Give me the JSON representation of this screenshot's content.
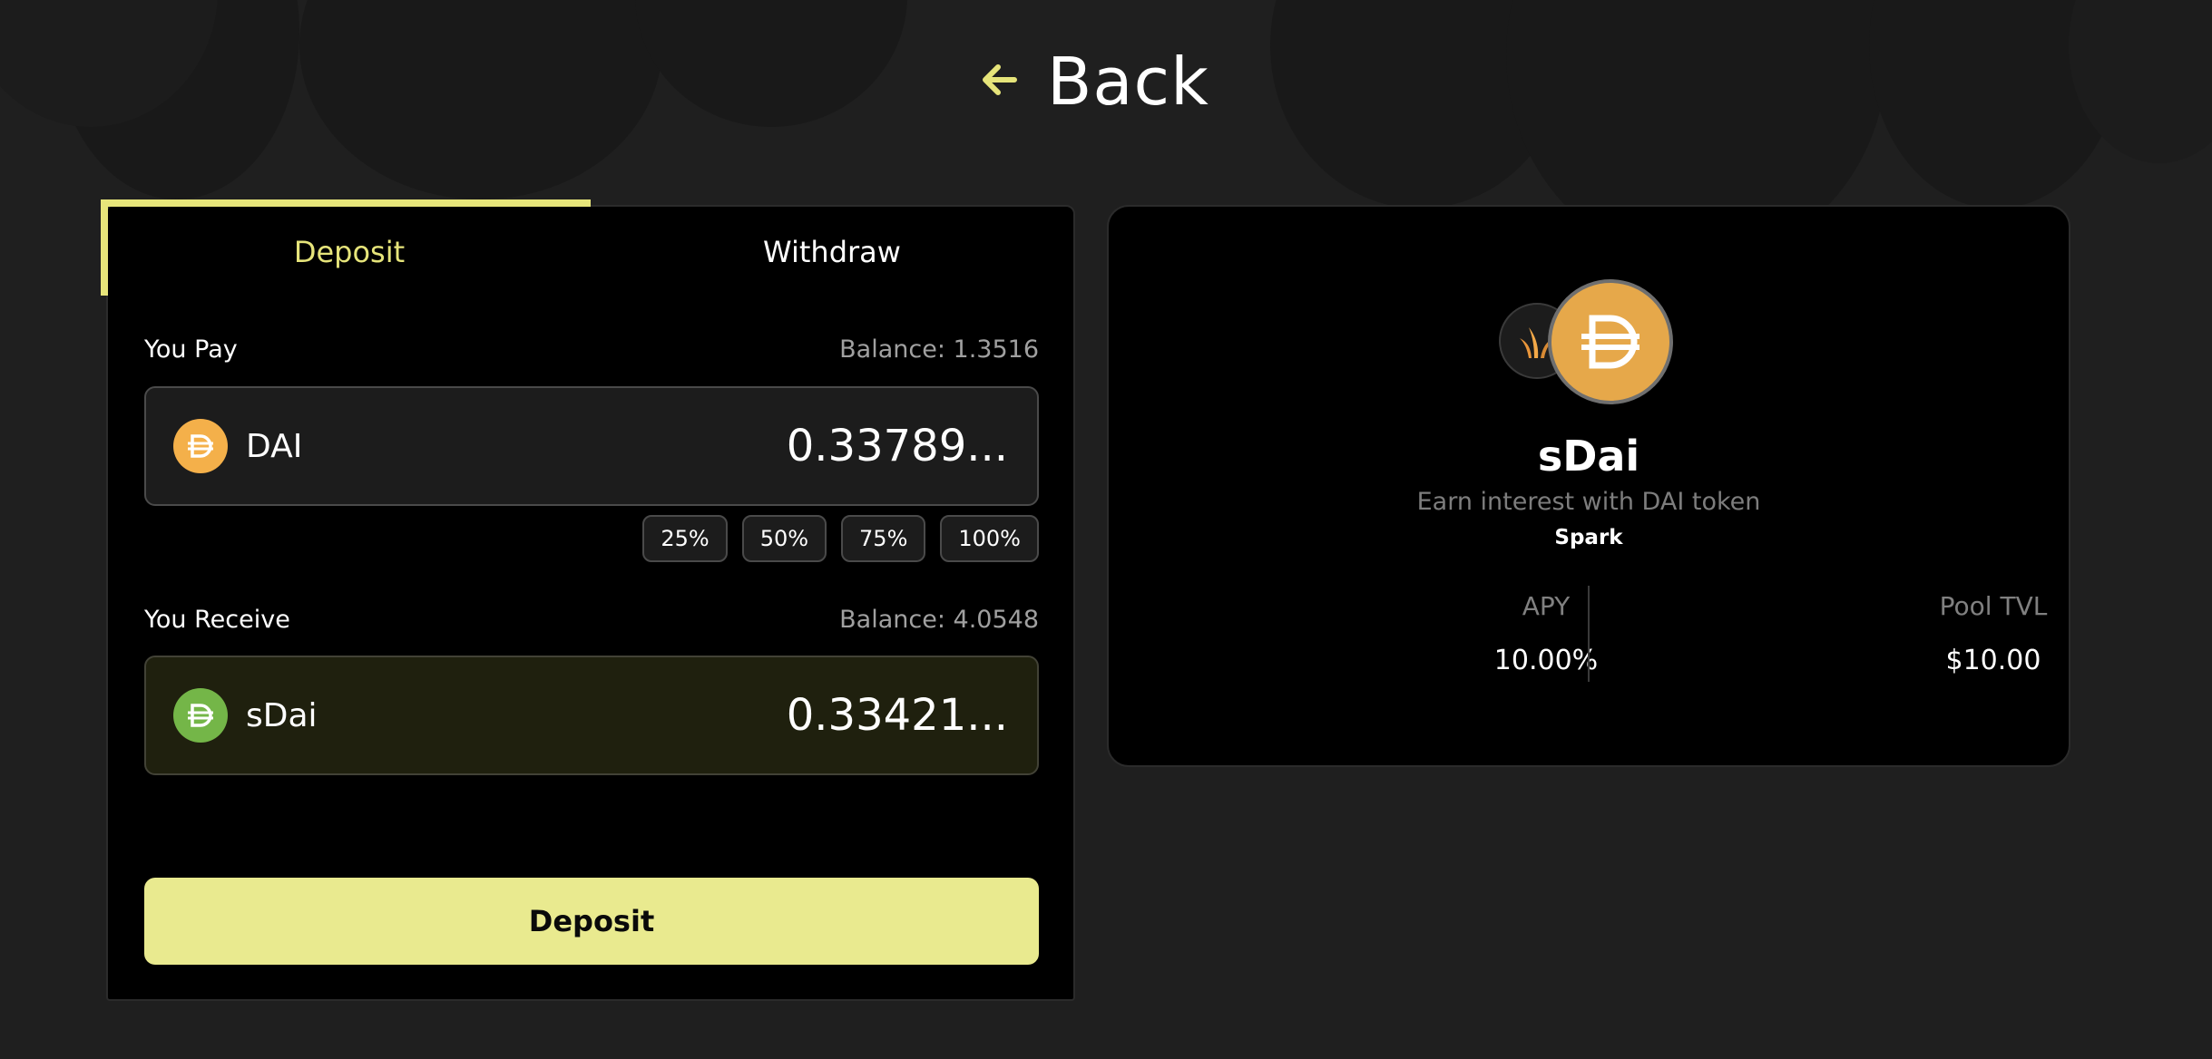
{
  "header": {
    "back_label": "Back",
    "back_icon": "arrow-left-icon",
    "accent_color": "#e6e47a"
  },
  "trade": {
    "tabs": [
      {
        "label": "Deposit",
        "active": true
      },
      {
        "label": "Withdraw",
        "active": false
      }
    ],
    "pay": {
      "label": "You Pay",
      "balance": "Balance: 1.3516",
      "token": "DAI",
      "token_icon": "dai-icon",
      "amount": "0.33789..."
    },
    "percent_buttons": [
      "25%",
      "50%",
      "75%",
      "100%"
    ],
    "receive": {
      "label": "You Receive",
      "balance": "Balance: 4.0548",
      "token": "sDai",
      "token_icon": "sdai-icon",
      "amount": "0.33421..."
    },
    "submit_label": "Deposit",
    "submit_color": "#e9ea8f"
  },
  "pool": {
    "title": "sDai",
    "subtitle": "Earn interest with DAI token",
    "provider": "Spark",
    "stats": [
      {
        "label": "APY",
        "value": "10.00%"
      },
      {
        "label": "Pool TVL",
        "value": "$10.00"
      }
    ]
  }
}
